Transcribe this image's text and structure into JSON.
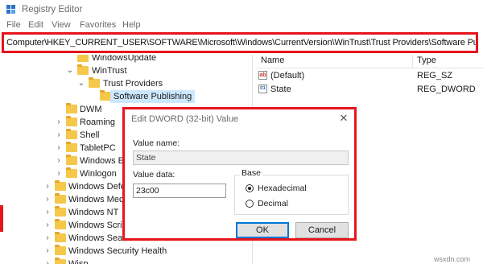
{
  "window": {
    "title": "Registry Editor"
  },
  "menu": [
    "File",
    "Edit",
    "View",
    "Favorites",
    "Help"
  ],
  "address": "Computer\\HKEY_CURRENT_USER\\SOFTWARE\\Microsoft\\Windows\\CurrentVersion\\WinTrust\\Trust Providers\\Software Publishing",
  "tree": [
    {
      "label": "WindowsUpdate",
      "chev": ""
    },
    {
      "label": "WinTrust",
      "chev": "⌄"
    },
    {
      "label": "Trust Providers",
      "chev": "⌄"
    },
    {
      "label": "Software Publishing",
      "chev": "",
      "selected": true
    },
    {
      "label": "DWM",
      "chev": ""
    },
    {
      "label": "Roaming",
      "chev": "›"
    },
    {
      "label": "Shell",
      "chev": "›"
    },
    {
      "label": "TabletPC",
      "chev": "›"
    },
    {
      "label": "Windows Er",
      "chev": "›"
    },
    {
      "label": "Winlogon",
      "chev": "›"
    },
    {
      "label": "Windows Defe",
      "chev": "›"
    },
    {
      "label": "Windows Med",
      "chev": "›"
    },
    {
      "label": "Windows NT",
      "chev": "›"
    },
    {
      "label": "Windows Scrip",
      "chev": "›"
    },
    {
      "label": "Windows Searc",
      "chev": "›"
    },
    {
      "label": "Windows Security Health",
      "chev": "›"
    },
    {
      "label": "Wisp",
      "chev": "›"
    }
  ],
  "list": {
    "headers": {
      "name": "Name",
      "type": "Type"
    },
    "rows": [
      {
        "icon": "ab",
        "name": "(Default)",
        "type": "REG_SZ"
      },
      {
        "icon": "01",
        "name": "State",
        "type": "REG_DWORD"
      }
    ]
  },
  "dialog": {
    "title": "Edit DWORD (32-bit) Value",
    "close": "✕",
    "value_name_label": "Value name:",
    "value_name": "State",
    "value_data_label": "Value data:",
    "value_data": "23c00",
    "base_label": "Base",
    "radios": [
      {
        "label": "Hexadecimal",
        "checked": true
      },
      {
        "label": "Decimal",
        "checked": false
      }
    ],
    "ok": "OK",
    "cancel": "Cancel"
  },
  "watermark": "wsxdn.com",
  "colors": {
    "highlight": "#e5161b",
    "selection": "#cce8ff",
    "folder": "#f5c84a"
  }
}
